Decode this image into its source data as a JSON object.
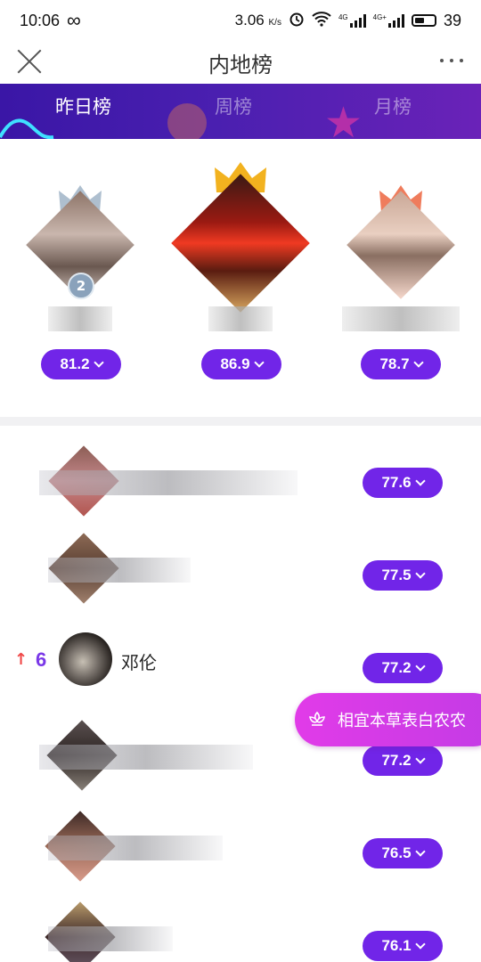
{
  "status_bar": {
    "time": "10:06",
    "infinity": "∞",
    "speed": "3.06",
    "speed_unit": "K/s",
    "net1": "4G",
    "net2": "4G+",
    "battery": "39"
  },
  "header": {
    "title": "内地榜",
    "close_icon": "close-icon",
    "more_icon": "more-icon"
  },
  "tabs": [
    {
      "label": "昨日榜",
      "active": true
    },
    {
      "label": "周榜",
      "active": false
    },
    {
      "label": "月榜",
      "active": false
    }
  ],
  "podium": [
    {
      "rank": "2",
      "score": "81.2"
    },
    {
      "rank": "1",
      "score": "86.9"
    },
    {
      "rank": "3",
      "score": "78.7"
    }
  ],
  "list": [
    {
      "score": "77.6"
    },
    {
      "score": "77.5"
    },
    {
      "trend": "↑",
      "rank": "6",
      "name": "邓伦",
      "score": "77.2"
    },
    {
      "score": "77.2"
    },
    {
      "score": "76.5"
    },
    {
      "score": "76.1"
    }
  ],
  "floating_button": {
    "label": "相宜本草表白农农",
    "icon": "flower-icon"
  },
  "colors": {
    "accent": "#7125e8",
    "banner_start": "#3a16a6",
    "banner_end": "#6a22b8",
    "float": "#dc3be8"
  }
}
